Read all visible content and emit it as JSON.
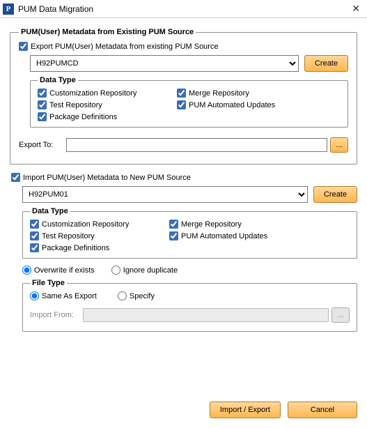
{
  "window": {
    "title": "PUM Data Migration",
    "app_icon_glyph": "P"
  },
  "export": {
    "group_title": "PUM(User) Metadata from Existing PUM Source",
    "checkbox_label": "Export PUM(User) Metadata from existing PUM Source",
    "checkbox_checked": true,
    "source_value": "H92PUMCD",
    "create_label": "Create",
    "data_type": {
      "legend": "Data Type",
      "customization": {
        "label": "Customization Repository",
        "checked": true
      },
      "merge": {
        "label": "Merge Repository",
        "checked": true
      },
      "test": {
        "label": "Test Repository",
        "checked": true
      },
      "automated": {
        "label": "PUM Automated Updates",
        "checked": true
      },
      "package": {
        "label": "Package Definitions",
        "checked": true
      }
    },
    "export_to": {
      "label": "Export To:",
      "value": "",
      "browse_label": "..."
    }
  },
  "import": {
    "checkbox_label": "Import PUM(User) Metadata to New PUM Source",
    "checkbox_checked": true,
    "source_value": "H92PUM01",
    "create_label": "Create",
    "data_type": {
      "legend": "Data Type",
      "customization": {
        "label": "Customization Repository",
        "checked": true
      },
      "merge": {
        "label": "Merge Repository",
        "checked": true
      },
      "test": {
        "label": "Test Repository",
        "checked": true
      },
      "automated": {
        "label": "PUM Automated Updates",
        "checked": true
      },
      "package": {
        "label": "Package Definitions",
        "checked": true
      }
    },
    "conflict": {
      "overwrite_label": "Overwrite if exists",
      "ignore_label": "Ignore duplicate",
      "selected": "overwrite"
    },
    "file_type": {
      "legend": "File Type",
      "same_label": "Same As Export",
      "specify_label": "Specify",
      "selected": "same",
      "import_from_label": "Import From:",
      "import_from_value": "",
      "browse_label": "..."
    }
  },
  "footer": {
    "import_export": "Import / Export",
    "cancel": "Cancel"
  }
}
